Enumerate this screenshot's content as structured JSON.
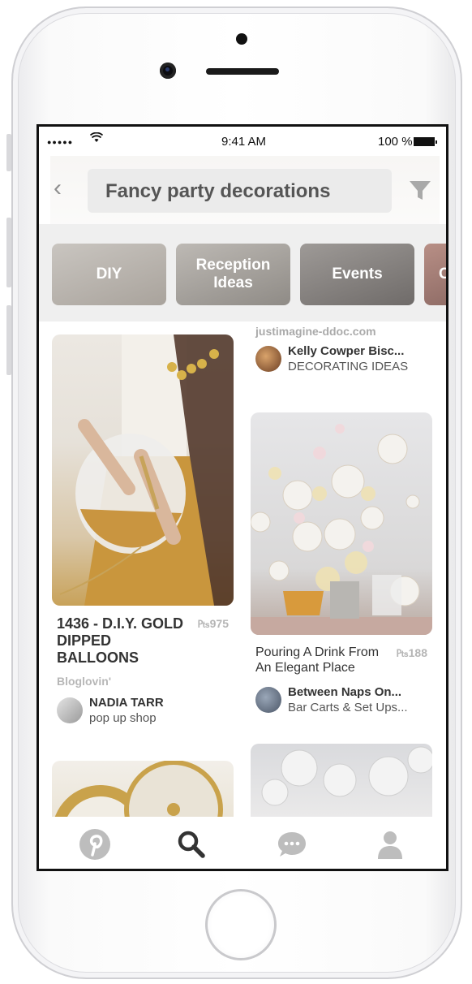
{
  "status_bar": {
    "signal": "●●●●●",
    "time": "9:41 AM",
    "battery": "100 %"
  },
  "search": {
    "query": "Fancy party decorations"
  },
  "guides": [
    {
      "label": "DIY"
    },
    {
      "label": "Reception Ideas"
    },
    {
      "label": "Events"
    },
    {
      "label": "C"
    }
  ],
  "feed": {
    "left": [
      {
        "title": "1436 - D.I.Y. GOLD DIPPED BALLOONS",
        "save_count": "975",
        "source": "Bloglovin'",
        "pinner": "NADIA TARR",
        "board": "pop up shop"
      }
    ],
    "right": [
      {
        "source": "justimagine-ddoc.com",
        "pinner": "Kelly Cowper Bisc...",
        "board": "DECORATING IDEAS"
      },
      {
        "title": "Pouring A Drink From An Elegant Place",
        "save_count": "188",
        "pinner": "Between Naps On...",
        "board": "Bar Carts & Set Ups..."
      }
    ]
  },
  "tab_bar": {
    "tabs": [
      "pinterest-logo-icon",
      "search-icon",
      "chat-icon",
      "profile-icon"
    ],
    "accent": "#bdbdbd",
    "active": "#333333"
  },
  "colors": {
    "search_field": "#ebebeb",
    "guide_strip": "#efefef",
    "title_dark": "#333333",
    "meta_grey": "#b5b5b5"
  }
}
